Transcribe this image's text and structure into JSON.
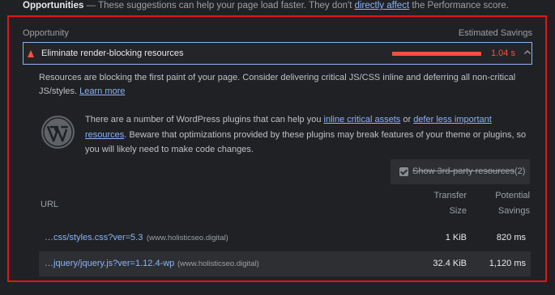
{
  "header": {
    "title": "Opportunities",
    "dash": " — ",
    "description_before": "These suggestions can help your page load faster. They don't ",
    "link": "directly affect",
    "description_after": " the Performance score."
  },
  "columns": {
    "opportunity": "Opportunity",
    "estimated_savings": "Estimated Savings"
  },
  "audit": {
    "title": "Eliminate render-blocking resources",
    "savings": "1.04 s",
    "severity": "fail",
    "severity_color": "#ff4e42",
    "expanded": true
  },
  "description": {
    "text": "Resources are blocking the first paint of your page. Consider delivering critical JS/CSS inline and deferring all non-critical JS/styles. ",
    "learn_more": "Learn more"
  },
  "wordpress_tip": {
    "icon": "wordpress-icon",
    "before": "There are a number of WordPress plugins that can help you ",
    "link1": "inline critical assets",
    "middle1": " or ",
    "link2": "defer less important resources",
    "after": ". Beware that optimizations provided by these plugins may break features of your theme or plugins, so you will likely need to make code changes."
  },
  "third_party_filter": {
    "label": "Show 3rd-party resources",
    "count": "(2)",
    "checked": true
  },
  "table": {
    "headers": {
      "url": "URL",
      "transfer_size_line1": "Transfer",
      "transfer_size_line2": "Size",
      "potential_savings_line1": "Potential",
      "potential_savings_line2": "Savings"
    },
    "rows": [
      {
        "url": "…css/styles.css?ver=5.3",
        "host": "(www.holisticseo.digital)",
        "transfer_size": "1 KiB",
        "potential_savings": "820 ms"
      },
      {
        "url": "…jquery/jquery.js?ver=1.12.4-wp",
        "host": "(www.holisticseo.digital)",
        "transfer_size": "32.4 KiB",
        "potential_savings": "1,120 ms"
      }
    ]
  },
  "highlight_color": "#e21515",
  "link_color": "#8ab4f8"
}
